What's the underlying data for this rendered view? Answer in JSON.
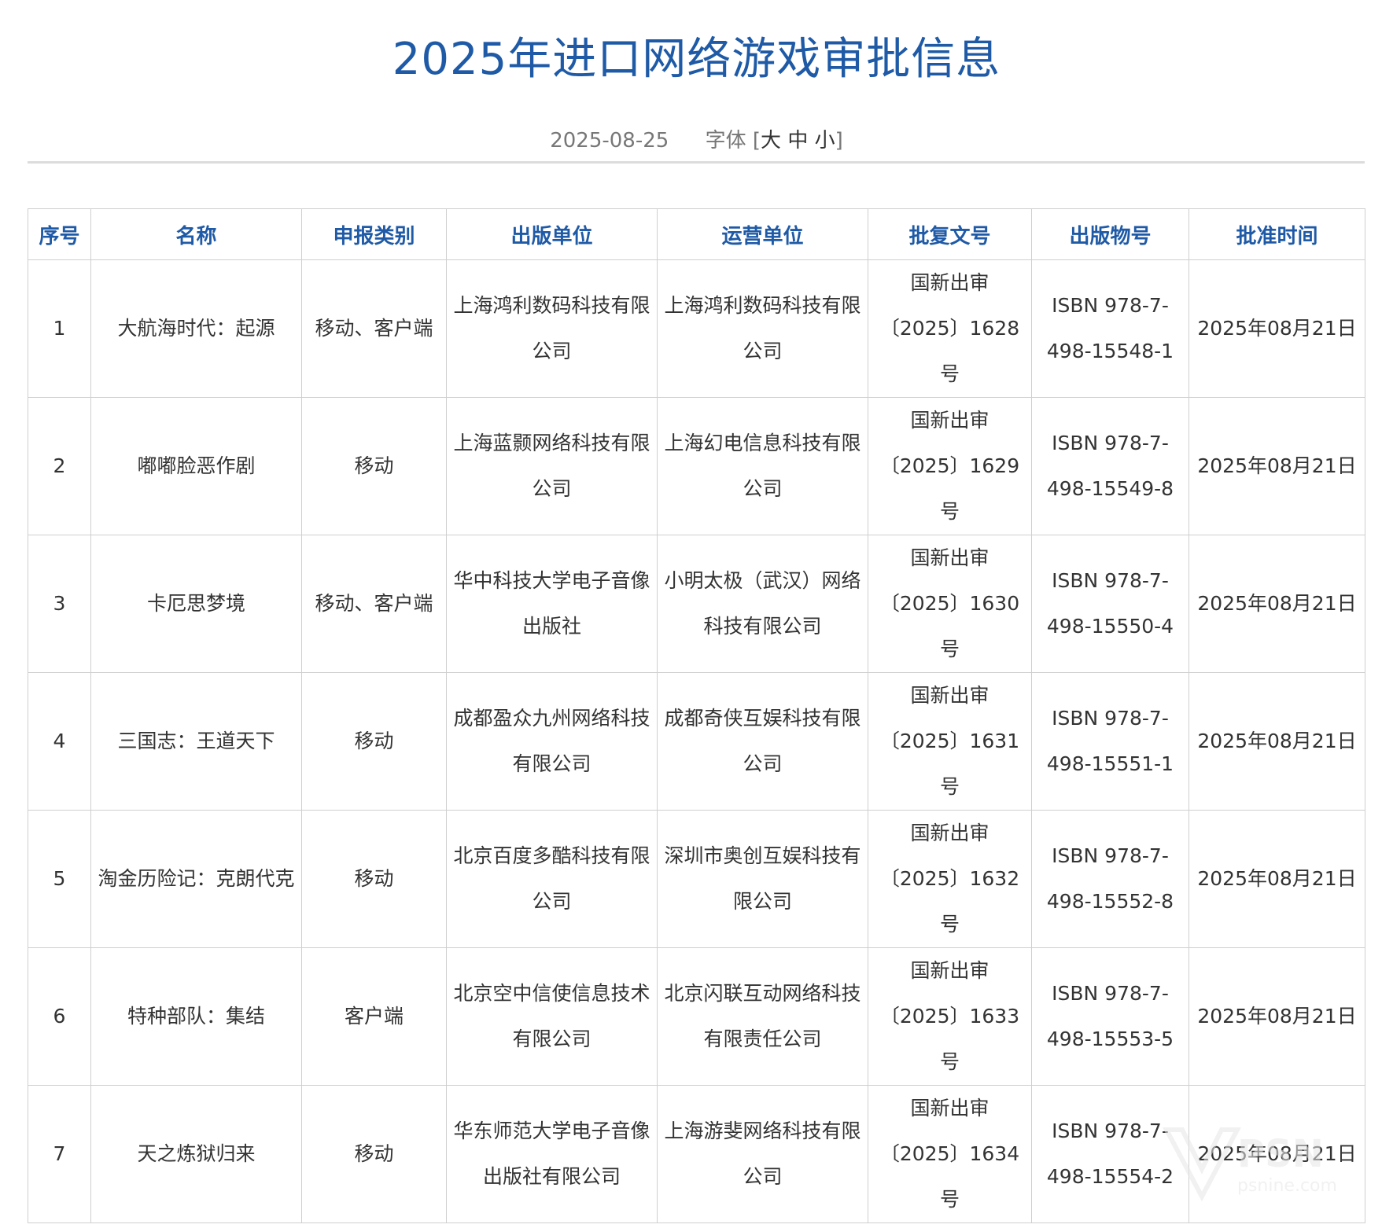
{
  "article": {
    "title": "2025年进口网络游戏审批信息",
    "date": "2025-08-25",
    "font_label": "字体",
    "font_open": "[",
    "font_large": "大",
    "font_medium": "中",
    "font_small": "小",
    "font_close": "]"
  },
  "table": {
    "headers": [
      "序号",
      "名称",
      "申报类别",
      "出版单位",
      "运营单位",
      "批复文号",
      "出版物号",
      "批准时间"
    ],
    "rows": [
      [
        "1",
        "大航海时代：起源",
        "移动、客户端",
        "上海鸿利数码科技有限公司",
        "上海鸿利数码科技有限公司",
        "国新出审〔2025〕1628号",
        "ISBN 978-7-498-15548-1",
        "2025年08月21日"
      ],
      [
        "2",
        "嘟嘟脸恶作剧",
        "移动",
        "上海蓝颢网络科技有限公司",
        "上海幻电信息科技有限公司",
        "国新出审〔2025〕1629号",
        "ISBN 978-7-498-15549-8",
        "2025年08月21日"
      ],
      [
        "3",
        "卡厄思梦境",
        "移动、客户端",
        "华中科技大学电子音像出版社",
        "小明太极（武汉）网络科技有限公司",
        "国新出审〔2025〕1630号",
        "ISBN 978-7-498-15550-4",
        "2025年08月21日"
      ],
      [
        "4",
        "三国志：王道天下",
        "移动",
        "成都盈众九州网络科技有限公司",
        "成都奇侠互娱科技有限公司",
        "国新出审〔2025〕1631号",
        "ISBN 978-7-498-15551-1",
        "2025年08月21日"
      ],
      [
        "5",
        "淘金历险记：克朗代克",
        "移动",
        "北京百度多酷科技有限公司",
        "深圳市奥创互娱科技有限公司",
        "国新出审〔2025〕1632号",
        "ISBN 978-7-498-15552-8",
        "2025年08月21日"
      ],
      [
        "6",
        "特种部队：集结",
        "客户端",
        "北京空中信使信息技术有限公司",
        "北京闪联互动网络科技有限责任公司",
        "国新出审〔2025〕1633号",
        "ISBN 978-7-498-15553-5",
        "2025年08月21日"
      ],
      [
        "7",
        "天之炼狱归来",
        "移动",
        "华东师范大学电子音像出版社有限公司",
        "上海游斐网络科技有限公司",
        "国新出审〔2025〕1634号",
        "ISBN 978-7-498-15554-2",
        "2025年08月21日"
      ]
    ]
  },
  "watermark": {
    "brand": "PSN",
    "sub": "psnine.com"
  }
}
